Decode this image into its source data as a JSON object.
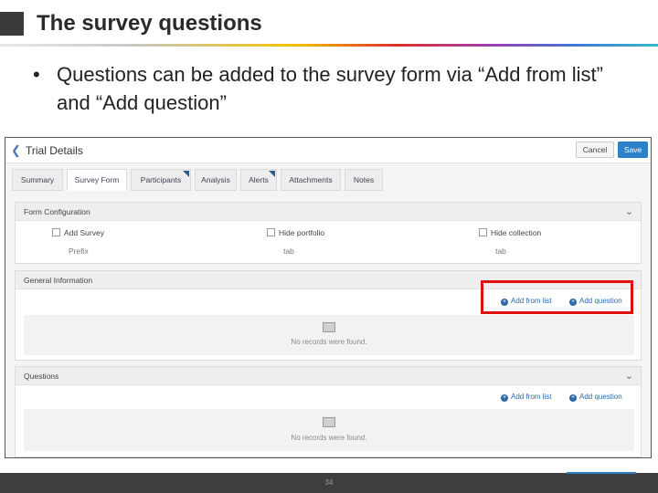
{
  "slide": {
    "title": "The survey questions",
    "bullet_symbol": "•",
    "bullet_text": "Questions can be added to the survey form via “Add from list” and “Add question”",
    "page_number": "34"
  },
  "app": {
    "back_icon": "chevron-left-icon",
    "title": "Trial Details",
    "cancel_label": "Cancel",
    "save_label": "Save",
    "tabs": [
      {
        "label": "Summary"
      },
      {
        "label": "Survey Form"
      },
      {
        "label": "Participants"
      },
      {
        "label": "Analysis"
      },
      {
        "label": "Alerts"
      },
      {
        "label": "Attachments"
      },
      {
        "label": "Notes"
      }
    ],
    "active_tab": "Survey Form",
    "form_configuration": {
      "title": "Form Configuration",
      "options": [
        {
          "label": "Add Survey",
          "value": "Prefix",
          "checked": false
        },
        {
          "label": "Hide portfolio",
          "value": "tab",
          "checked": false
        },
        {
          "label": "Hide collection",
          "value": "tab",
          "checked": false
        }
      ]
    },
    "general_information": {
      "title": "General Information",
      "add_from_list": "Add from list",
      "add_question": "Add question",
      "empty_text": "No records were found."
    },
    "questions": {
      "title": "Questions",
      "add_from_list": "Add from list",
      "add_question": "Add question",
      "empty_text": "No records were found."
    }
  },
  "colors": {
    "primary_button": "#2e7fc9",
    "highlight_box": "#e01010",
    "link": "#2e6aa8"
  }
}
